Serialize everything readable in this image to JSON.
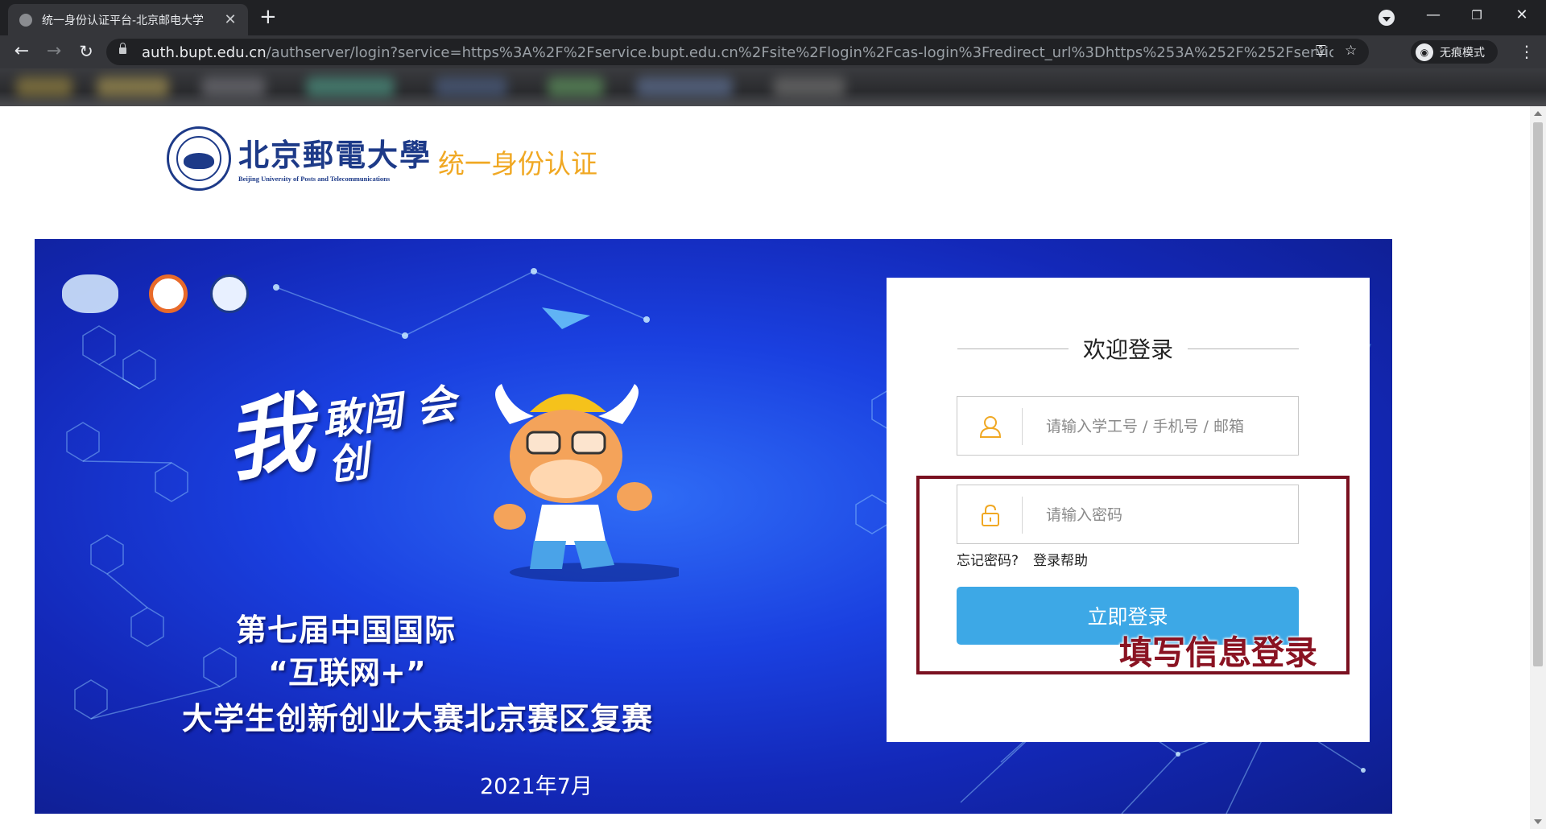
{
  "browser": {
    "tab": {
      "title": "统一身份认证平台-北京邮电大学"
    },
    "address": {
      "host": "auth.bupt.edu.cn",
      "path": "/authserver/login?service=https%3A%2F%2Fservice.bupt.edu.cn%2Fsite%2Flogin%2Fcas-login%3Fredirect_url%3Dhttps%253A%252F%252Fservice.bupt.edu.c..."
    },
    "profile_label": "无痕模式"
  },
  "header": {
    "university_cn": "北京郵電大學",
    "university_en": "Beijing University of Posts and Telecommunications",
    "platform_title": "统一身份认证"
  },
  "banner": {
    "slogan": "我",
    "slogan_small": "敢闯 会创",
    "line1": "第七届中国国际",
    "line2": "“互联网+”",
    "line3": "大学生创新创业大赛北京赛区复赛",
    "date": "2021年7月"
  },
  "login": {
    "welcome": "欢迎登录",
    "username_placeholder": "请输入学工号 / 手机号 / 邮箱",
    "password_placeholder": "请输入密码",
    "forgot_password": "忘记密码?",
    "login_help": "登录帮助",
    "submit_label": "立即登录"
  },
  "annotation": {
    "text": "填写信息登录",
    "color": "#8a1322"
  },
  "colors": {
    "accent_blue": "#3da8e6",
    "brand_navy": "#1d3a88",
    "platform_orange": "#f0a823"
  }
}
